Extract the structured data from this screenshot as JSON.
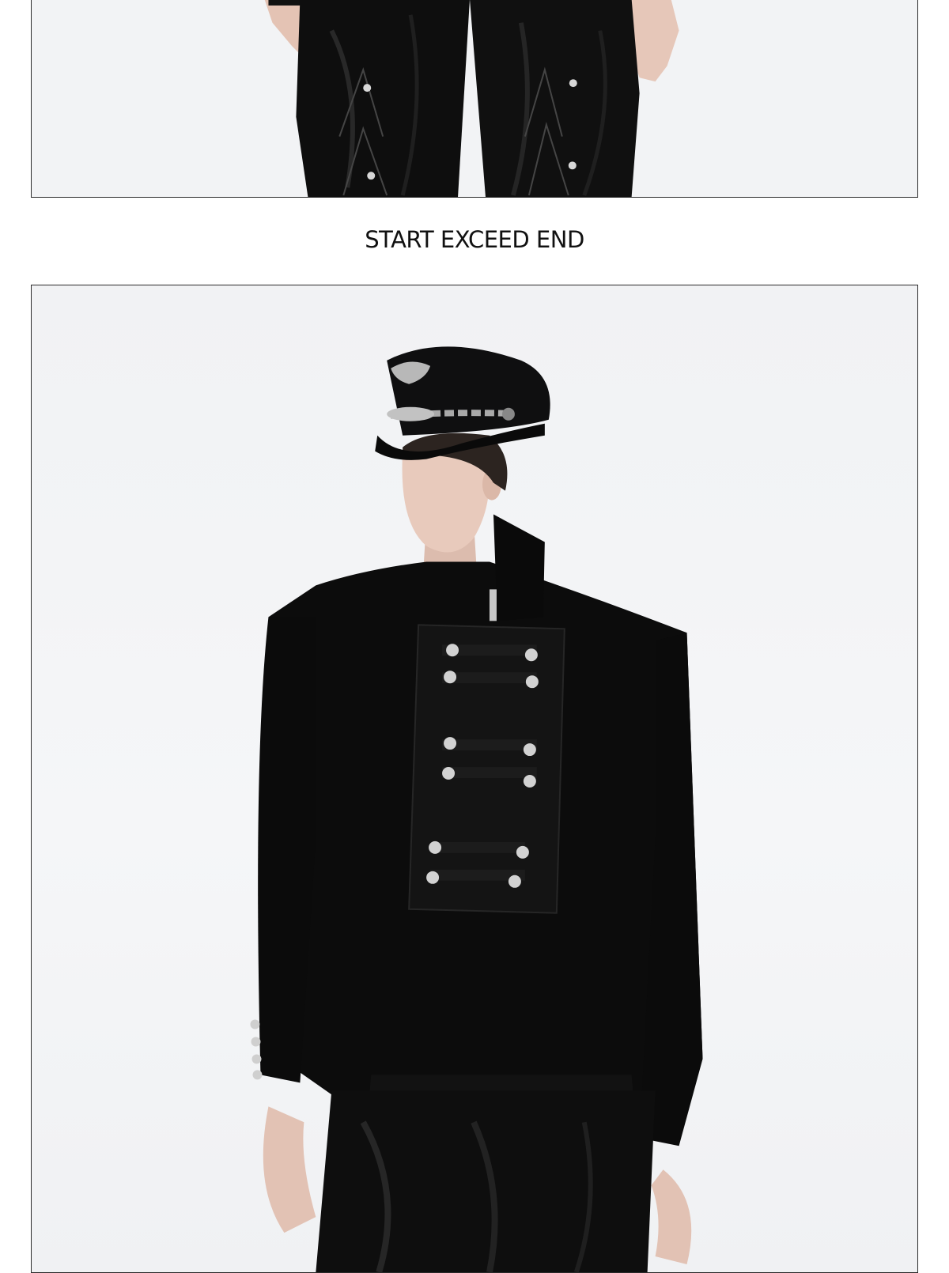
{
  "caption": "START EXCEED END",
  "photos": {
    "top": {
      "icon": "fashion-photo-icon",
      "subject": "lower-body-black-leather-trousers"
    },
    "bottom": {
      "icon": "fashion-photo-icon",
      "subject": "model-black-military-jacket-and-cap"
    }
  },
  "colors": {
    "background": "#ffffff",
    "frame_border": "#2b2b2b",
    "caption_text": "#111111",
    "garment_black": "#0d0d0d",
    "metal_silver": "#c8c8c8"
  }
}
